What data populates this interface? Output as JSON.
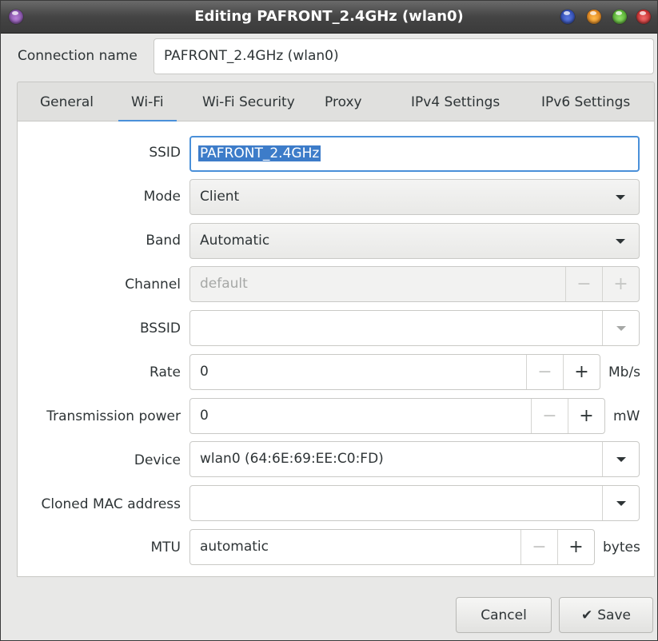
{
  "window": {
    "title": "Editing PAFRONT_2.4GHz (wlan0)"
  },
  "connection": {
    "label": "Connection name",
    "value": "PAFRONT_2.4GHz (wlan0)"
  },
  "tabs": [
    {
      "label": "General"
    },
    {
      "label": "Wi-Fi",
      "active": true
    },
    {
      "label": "Wi-Fi Security"
    },
    {
      "label": "Proxy"
    },
    {
      "label": "IPv4 Settings"
    },
    {
      "label": "IPv6 Settings"
    }
  ],
  "wifi": {
    "ssid": {
      "label": "SSID",
      "value": "PAFRONT_2.4GHz"
    },
    "mode": {
      "label": "Mode",
      "value": "Client"
    },
    "band": {
      "label": "Band",
      "value": "Automatic"
    },
    "channel": {
      "label": "Channel",
      "value": "default"
    },
    "bssid": {
      "label": "BSSID",
      "value": ""
    },
    "rate": {
      "label": "Rate",
      "value": "0",
      "unit": "Mb/s"
    },
    "tx_power": {
      "label": "Transmission power",
      "value": "0",
      "unit": "mW"
    },
    "device": {
      "label": "Device",
      "value": "wlan0 (64:6E:69:EE:C0:FD)"
    },
    "cloned_mac": {
      "label": "Cloned MAC address",
      "value": ""
    },
    "mtu": {
      "label": "MTU",
      "value": "automatic",
      "unit": "bytes"
    }
  },
  "spin": {
    "minus": "−",
    "plus": "+"
  },
  "buttons": {
    "cancel": "Cancel",
    "save_icon": "✔",
    "save": "Save"
  },
  "colors": {
    "accent": "#4a90d9",
    "selection": "#3d7cc9"
  },
  "icons": [
    "window-menu-icon",
    "minimize-icon",
    "shade-icon",
    "maximize-icon",
    "close-icon",
    "dropdown-arrow-icon",
    "checkmark-icon"
  ]
}
